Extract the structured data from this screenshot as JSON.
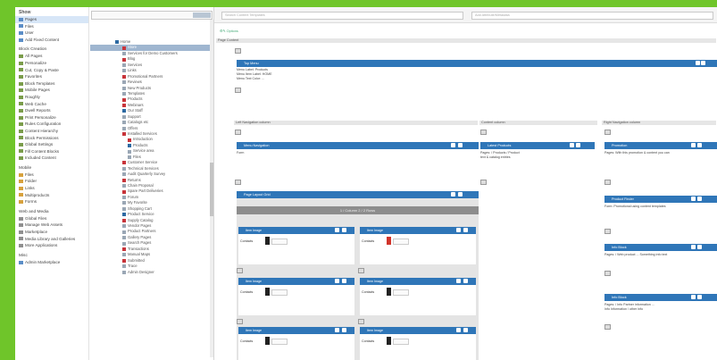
{
  "colors": {
    "background": "#6fc52a",
    "accent": "#2f76b8",
    "selected": "#d7e6f7"
  },
  "left": {
    "title": "Show",
    "items": [
      "Pages",
      "Files",
      "User",
      "Add Fixed Content"
    ],
    "section_b_title": "Block Creation",
    "section_b": [
      "All Pages",
      "Personalize",
      "Cut, Copy & Paste",
      "Favorites",
      "Block Templates",
      "Mobile Pages",
      "Roughly",
      "Web Cache",
      "Dwell Reports",
      "Print Personalize",
      "Rules Configuration",
      "Content Hierarchy",
      "Block Permissions",
      "Global Settings",
      "Fill Content Blocks",
      "Included Content"
    ],
    "section_c_title": "Mobile",
    "section_c": [
      "Files",
      "Folder",
      "Links",
      "Multiproducts",
      "Forms"
    ],
    "section_d_title": "Web and Media",
    "section_d": [
      "Global Files",
      "Manage Web Assets",
      "Marketplace",
      "Media Library and Galleries",
      "More Applications"
    ],
    "section_e_title": "Misc",
    "section_e": [
      "Admin Marketplace"
    ]
  },
  "tree": {
    "search_placeholder": "",
    "nodes": [
      "Home",
      "Store",
      "Services for Demo Customers",
      "Blog",
      "Services",
      "Links",
      "Promotional Partners",
      "Reviews",
      "New Products",
      "Templates",
      "Products",
      "Webinars",
      "Our Staff",
      "Support",
      "Catalogs etc",
      "Offers",
      "Installed Services",
      "Introduction",
      "Products",
      "Service area",
      "Files",
      "Customer Service",
      "Technical Services",
      "Audit Quarterly Survey",
      "Returns",
      "Chain Proposal",
      "Spare Part Deliveries",
      "Forum",
      "My Favorite",
      "Shopping Cart",
      "Product Service",
      "Supply Catalog",
      "Vendor Pages",
      "Product Partners",
      "Gallery Pages",
      "Search Pages",
      "Transactions",
      "Manual Maps",
      "Submitted",
      "Trace",
      "Admin Designer"
    ]
  },
  "main": {
    "search1_placeholder": "Search Content Templates",
    "search2_placeholder": "Add Attribute/Metadata",
    "toolbar_label": "Options",
    "top_section": "Page Content",
    "block1": {
      "title": "Top Menu",
      "line1": "Menu Label: Products",
      "line2": "Menu Item Label: HOME",
      "line3": "Menu Text Color: ..."
    },
    "col_left_title": "Left Navigation column",
    "col_mid_title": "Content column",
    "col_right_title": "Right Navigation column",
    "left_block": {
      "title": "Menu Navigation",
      "text": "Form"
    },
    "mid_block": {
      "title": "Latest Products",
      "text1": "Pages: / Products / Product",
      "text2": "text & catalog entries"
    },
    "right_block": {
      "title": "Promotion",
      "text": "Pages: With this promotion & content you can"
    },
    "grid_block_title": "Page Layout Grid",
    "grid_band": "1 / Column 2 / 2 Rows",
    "cells": [
      {
        "title": "Item Image",
        "label": "Contacts"
      },
      {
        "title": "Item Image",
        "label": "Contacts"
      },
      {
        "title": "Item Image",
        "label": "Contacts"
      },
      {
        "title": "Item Image",
        "label": "Contacts"
      },
      {
        "title": "Item Image",
        "label": "Contacts"
      },
      {
        "title": "Item Image",
        "label": "Contacts"
      }
    ],
    "right_blocks": [
      {
        "title": "Product Finder",
        "text": "Form: Promotional using content templates"
      },
      {
        "title": "Info Block",
        "text": "Pages: / Web product ... Something info text"
      },
      {
        "title": "Info Block",
        "text1": "Pages: / Info Partner information ...",
        "text2": "Info Information / other info"
      }
    ]
  }
}
